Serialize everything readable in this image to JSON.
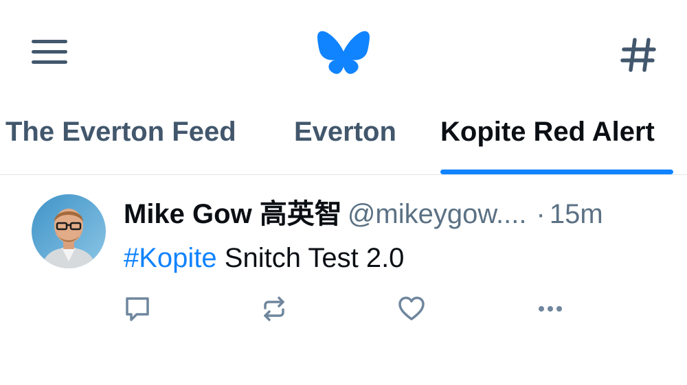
{
  "header": {
    "logo_icon": "bluesky-butterfly-icon",
    "logo_color": "#1083fe",
    "menu_icon": "hamburger-menu-icon",
    "feeds_icon": "hashtag-icon"
  },
  "tabs": [
    {
      "label": "The Everton Feed",
      "active": false
    },
    {
      "label": "Everton",
      "active": false
    },
    {
      "label": "Kopite Red Alert",
      "active": true
    }
  ],
  "post": {
    "author_name": "Mike Gow 高英智",
    "handle": "@mikeygow....",
    "separator": "·",
    "time": "15m",
    "hashtag": "#Kopite",
    "text": " Snitch Test 2.0",
    "actions": {
      "reply_icon": "reply-icon",
      "repost_icon": "repost-icon",
      "like_icon": "heart-icon",
      "more_icon": "more-options-icon"
    }
  },
  "colors": {
    "accent": "#1083fe",
    "muted_text": "#5b7184",
    "primary_text": "#0b0f14",
    "icon": "#42576c"
  }
}
